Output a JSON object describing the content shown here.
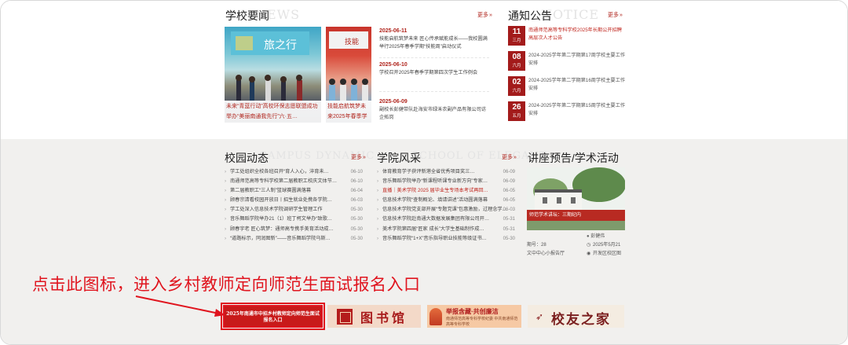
{
  "news": {
    "title": "学校要闻",
    "ghost": "NEWS",
    "more": "更多",
    "photo_captions": [
      "未来“青蓝行动”高校环保志愿联盟成功举办“美丽南通我先行”六·五…",
      "技能启航筑梦未来2025年春季学期"
    ],
    "items": [
      {
        "date": "2025-06-11",
        "text": "技能启航筑梦未来 匠心传承赋能成长——我校圆满举行2025年春季学期“技能周”启动仪式"
      },
      {
        "date": "2025-06-10",
        "text": "学校召开2025年春季学期第四次学生工作例会"
      },
      {
        "date": "2025-06-09",
        "text": "副校长彭健带队赴海安市绿禾农副产品有限公司访企拓岗"
      }
    ]
  },
  "notice": {
    "title": "通知公告",
    "ghost": "NOTICE",
    "more": "更多",
    "items": [
      {
        "day": "11",
        "month": "三月",
        "text": "南通师范高等专科学校2025年长期公开招聘高层次人才公告",
        "hot": true
      },
      {
        "day": "08",
        "month": "六月",
        "text": "2024-2025学年第二学期第17周学校主要工作安排",
        "hot": false
      },
      {
        "day": "02",
        "month": "六月",
        "text": "2024-2025学年第二学期第16周学校主要工作安排",
        "hot": false
      },
      {
        "day": "26",
        "month": "五月",
        "text": "2024-2025学年第二学期第15周学校主要工作安排",
        "hot": false
      }
    ]
  },
  "campus": {
    "title": "校园动态",
    "ghost": "CAMPUS DYNAMIC",
    "more": "更多",
    "items": [
      {
        "text": "学工处组织全校各班召开“育人入心，淬育未…",
        "date": "06-10"
      },
      {
        "text": "南通师范高等专科学校第二届教职工校庆文体节…",
        "date": "06-10"
      },
      {
        "text": "第二届教职工“三人制”篮球赛圆满落幕",
        "date": "06-04"
      },
      {
        "text": "顾春宗清看校园开放日丨招生就业处携各学院…",
        "date": "06-03"
      },
      {
        "text": "学工处深入信息技术学院调研学生管理工作",
        "date": "05-30"
      },
      {
        "text": "音乐舞蹈学院举办21（1）班丁柯文举办“致歌…",
        "date": "05-30"
      },
      {
        "text": "顾春宇老 匠心筑梦：通师高专携手美育活动成…",
        "date": "05-30"
      },
      {
        "text": "“道路标示，同润图新”——音乐舞蹈学院乌斯…",
        "date": "05-30"
      }
    ]
  },
  "college": {
    "title": "学院风采",
    "ghost": "SCHOOL OF ELEGANT",
    "more": "更多",
    "items": [
      {
        "text": "体育教育学子获评新港全省优秀项目奖三…",
        "date": "06-09",
        "hot": false
      },
      {
        "text": "音乐舞蹈学院举办“新课程听课专业新方向”专家…",
        "date": "06-09",
        "hot": false
      },
      {
        "text": "直播｜美术学院 2025 届毕业生专场本考试再回…",
        "date": "06-05",
        "hot": true
      },
      {
        "text": "信息技术学院“查制概论、填请讲述”活动圆满落幕",
        "date": "06-05",
        "hot": false
      },
      {
        "text": "信息技术学院党支部开展“专题党课”包惠激励，过理念学…",
        "date": "06-03",
        "hot": false
      },
      {
        "text": "信息技术学院赴南通大数据发展集团有限公司开…",
        "date": "05-31",
        "hot": false
      },
      {
        "text": "美术学院第四届“匠家 成长”大学生基础制作成…",
        "date": "05-31",
        "hot": false
      },
      {
        "text": "音乐舞蹈学院“1+X”音乐指导职业技能等级证书…",
        "date": "05-30",
        "hot": false
      }
    ]
  },
  "lecture": {
    "title": "讲座预告/学术活动",
    "banner": "师范学术讲坛：三期纪内",
    "name": "彭健伟",
    "period": "期号：28",
    "date": "2025年5月21",
    "place": "文中中心小报告厅",
    "location": "开发区校区图"
  },
  "annotation": {
    "text": "点击此图标，进入乡村教师定向师范生面试报名入口",
    "color": "#e0141e"
  },
  "banners": {
    "rural": "2025年南通市中招乡村教师定向师范生面试报名入口",
    "library": "图书馆",
    "care_title": "举报含藏·共创廉洁",
    "care_sub": "南通师范高等专科学校纪委 中共南通师范高等专科学校",
    "alumni": "校友之家"
  },
  "colors": {
    "accent": "#a31b1b",
    "hot_text": "#c0261e",
    "band_bg": "#f1f0ee"
  }
}
